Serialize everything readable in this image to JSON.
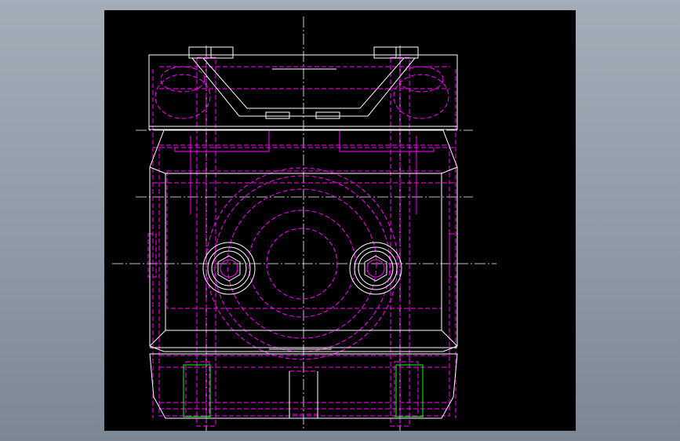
{
  "viewport": {
    "background": "#000000",
    "colors": {
      "visible_edge": "#ffffff",
      "hidden_edge": "#ff00ff",
      "highlight_edge": "#00ff00",
      "window_bg_top": "#a3adb8",
      "window_bg_bottom": "#7b8793"
    },
    "icons": [
      "hex-socket-bolt-left-icon",
      "hex-socket-bolt-right-icon"
    ]
  }
}
